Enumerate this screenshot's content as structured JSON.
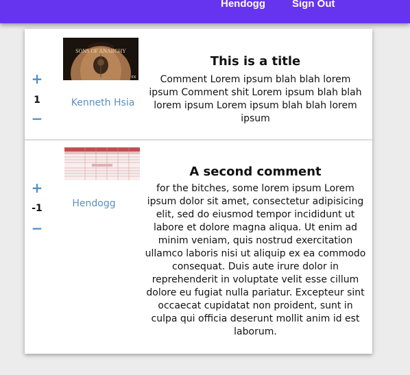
{
  "nav": {
    "user_label": "Hendogg",
    "signout_label": "Sign Out"
  },
  "comments": [
    {
      "score": "1",
      "author": "Kenneth Hsia",
      "title": "This is a title",
      "body": "Comment Lorem ipsum blah blah lorem ipsum Comment shit Lorem ipsum blah blah lorem ipsum Lorem ipsum blah blah lorem ipsum",
      "thumb_text": "SONS OF ANARCHY",
      "thumb_corner": "FX"
    },
    {
      "score": "-1",
      "author": "Hendogg",
      "title": "A second comment",
      "body": "for the bitches, some lorem ipsum Lorem ipsum dolor sit amet, consectetur adipisicing elit, sed do eiusmod tempor incididunt ut labore et dolore magna aliqua. Ut enim ad minim veniam, quis nostrud exercitation ullamco laboris nisi ut aliquip ex ea commodo consequat. Duis aute irure dolor in reprehenderit in voluptate velit esse cillum dolore eu fugiat nulla pariatur. Excepteur sint occaecat cupidatat non proident, sunt in culpa qui officia deserunt mollit anim id est laborum."
    }
  ],
  "vote": {
    "up": "+",
    "down": "−"
  },
  "colors": {
    "nav": "#6633ee",
    "link": "#4f90c8"
  }
}
